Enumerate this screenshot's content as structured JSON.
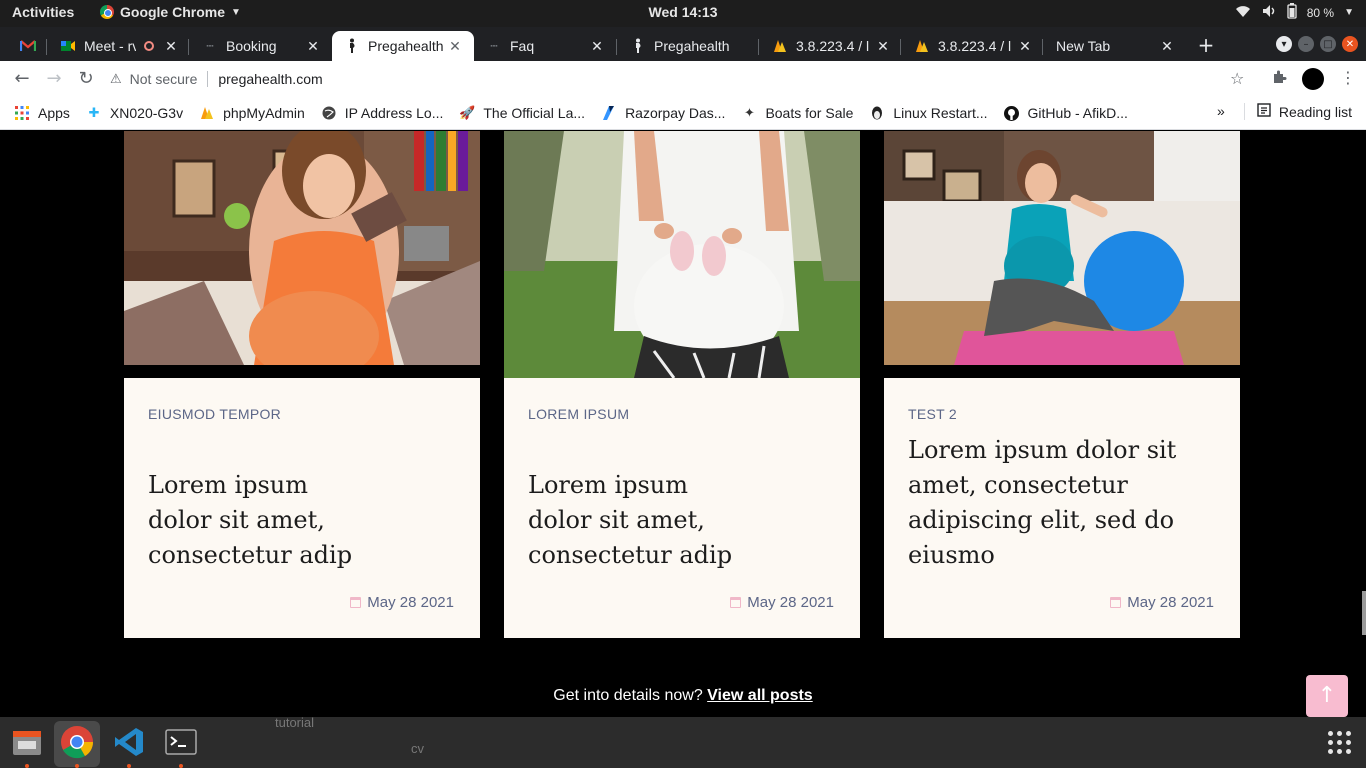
{
  "system_bar": {
    "activities": "Activities",
    "app_name": "Google Chrome",
    "clock": "Wed 14:13",
    "battery": "80 %"
  },
  "tabs": [
    {
      "title": "Meet - rv",
      "icon": "google-meet-icon"
    },
    {
      "title": "Booking",
      "icon": "site-icon"
    },
    {
      "title": "Pregahealth",
      "icon": "pregnant-woman-icon",
      "active": true
    },
    {
      "title": "Faq",
      "icon": "site-icon"
    },
    {
      "title": "Pregahealth",
      "icon": "pregnant-woman-icon"
    },
    {
      "title": "3.8.223.4 / l",
      "icon": "phpmyadmin-icon"
    },
    {
      "title": "3.8.223.4 / l",
      "icon": "phpmyadmin-icon"
    },
    {
      "title": "New Tab",
      "icon": ""
    }
  ],
  "omnibox": {
    "security": "Not secure",
    "url": "pregahealth.com"
  },
  "bookmarks": [
    {
      "label": "Apps",
      "icon": "apps-grid-icon"
    },
    {
      "label": "XN020-G3v",
      "icon": "puzzle-icon"
    },
    {
      "label": "phpMyAdmin",
      "icon": "phpmyadmin-icon"
    },
    {
      "label": "IP Address Lo...",
      "icon": "globe-icon"
    },
    {
      "label": "The Official La...",
      "icon": "rocket-icon"
    },
    {
      "label": "Razorpay Das...",
      "icon": "razorpay-icon"
    },
    {
      "label": "Boats for Sale",
      "icon": "compass-icon"
    },
    {
      "label": "Linux Restart...",
      "icon": "linux-icon"
    },
    {
      "label": "GitHub - AfikD...",
      "icon": "github-icon"
    }
  ],
  "reading_list": "Reading list",
  "posts": [
    {
      "category": "EIUSMOD TEMPOR",
      "title": "Lorem ipsum dolor sit amet, consectetur adip",
      "date": "May 28 2021",
      "image": "pregnant woman with apple and chocolate"
    },
    {
      "category": "LOREM IPSUM",
      "title": "Lorem ipsum dolor sit amet, consectetur adip",
      "date": "May 28 2021",
      "image": "pregnant belly with baby shoes"
    },
    {
      "category": "TEST 2",
      "title": "Lorem ipsum dolor sit amet, consectetur adipiscing elit, sed do eiusmo",
      "date": "May 28 2021",
      "image": "pregnant woman with exercise ball"
    }
  ],
  "cta": {
    "text": "Get into details now?",
    "link": "View all posts"
  },
  "desktop_labels": [
    "tutorial",
    "cv"
  ]
}
